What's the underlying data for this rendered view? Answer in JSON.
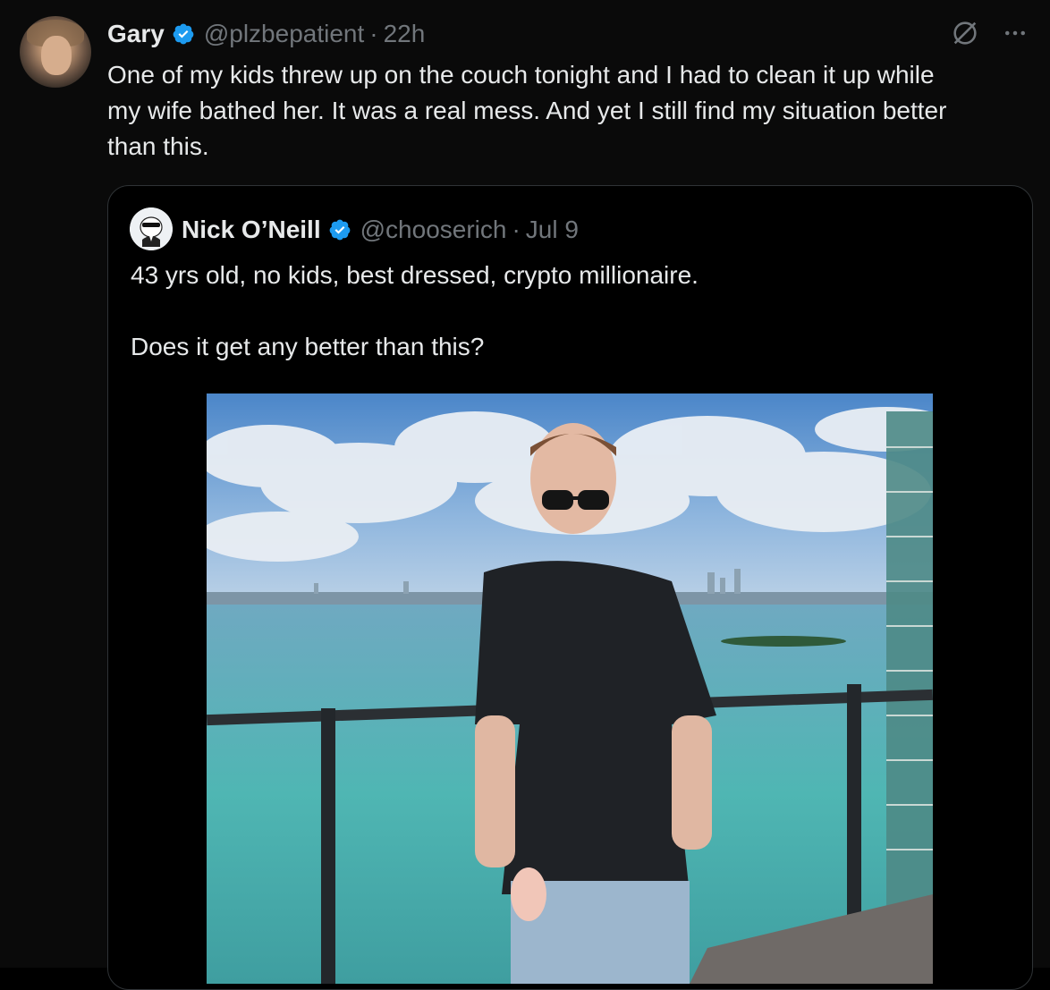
{
  "tweet": {
    "author_name": "Gary",
    "author_handle": "@plzbepatient",
    "separator": "·",
    "time": "22h",
    "text": "One of my kids threw up on the couch tonight and I had to clean it up while\nmy wife bathed her. It was a real mess. And yet I still find my situation better\nthan this.",
    "icons": [
      "grok-icon",
      "more-icon"
    ]
  },
  "quoted": {
    "author_name": "Nick O’Neill",
    "author_handle": "@chooserich",
    "separator": "·",
    "time": "Jul 9",
    "text": "43 yrs old, no kids, best dressed, crypto millionaire.\n\nDoes it get any better than this?"
  },
  "colors": {
    "background": "#0a0a0a",
    "text": "#e7e9ea",
    "muted": "#71767b",
    "verified": "#1d9bf0",
    "border": "#2f3336"
  }
}
